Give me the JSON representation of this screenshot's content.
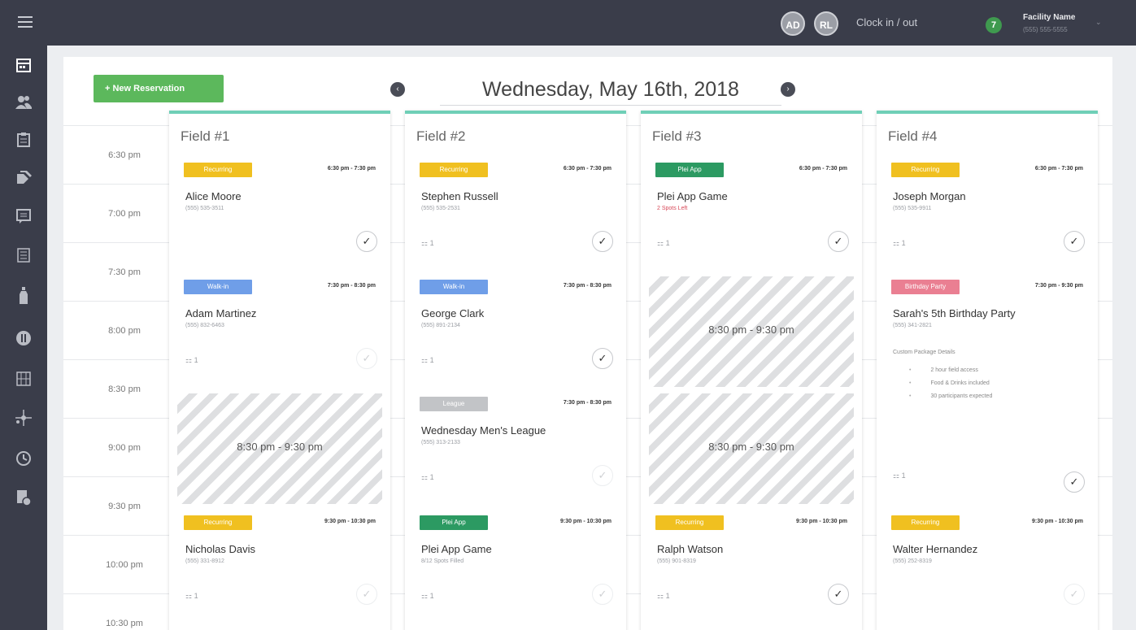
{
  "topbar": {
    "menu_icon": "hamburger-icon",
    "avatars": [
      "AD",
      "RL"
    ],
    "clock_label": "Clock in / out",
    "facility_badge": "7",
    "facility_name": "Facility Name",
    "facility_phone": "(555) 555-5555"
  },
  "sidebar": {
    "icons": [
      "calendar-icon",
      "users-icon",
      "clipboard-icon",
      "tags-icon",
      "message-icon",
      "list-icon",
      "bottle-icon",
      "whistle-icon",
      "grid-icon",
      "network-icon",
      "history-icon",
      "settings-doc-icon"
    ]
  },
  "toolbar": {
    "new_reservation": "+ New Reservation",
    "prev_icon": "chevron-left-icon",
    "next_icon": "chevron-right-icon",
    "date": "Wednesday, May 16th, 2018"
  },
  "times": [
    "6:30 pm",
    "7:00 pm",
    "7:30 pm",
    "8:00 pm",
    "8:30 pm",
    "9:00 pm",
    "9:30 pm",
    "10:00 pm",
    "10:30 pm"
  ],
  "fields": [
    {
      "title": "Field #1",
      "cards": [
        {
          "tag": "Recurring",
          "time": "6:30 pm - 7:30 pm",
          "name": "Alice Moore",
          "sub": "(555) 535-3511",
          "count": ""
        },
        {
          "tag": "Walk-in",
          "time": "7:30 pm - 8:30 pm",
          "name": "Adam Martinez",
          "sub": "(555) 832-6463",
          "count": "1"
        },
        {
          "block": "8:30 pm - 9:30 pm"
        },
        {
          "tag": "Recurring",
          "time": "9:30 pm - 10:30 pm",
          "name": "Nicholas Davis",
          "sub": "(555) 331-8912",
          "count": "1"
        }
      ]
    },
    {
      "title": "Field #2",
      "cards": [
        {
          "tag": "Recurring",
          "time": "6:30 pm - 7:30 pm",
          "name": "Stephen Russell",
          "sub": "(555) 535-2531",
          "count": "1"
        },
        {
          "tag": "Walk-in",
          "time": "7:30 pm - 8:30 pm",
          "name": "George Clark",
          "sub": "(555) 891-2134",
          "count": "1"
        },
        {
          "tag": "League",
          "time": "7:30 pm - 8:30 pm",
          "name": "Wednesday Men's League",
          "sub": "(555) 313-2133",
          "count": "1"
        },
        {
          "tag": "Plei App",
          "time": "9:30 pm - 10:30 pm",
          "name": "Plei App Game",
          "sub": "8/12 Spots Filled",
          "count": "1"
        }
      ]
    },
    {
      "title": "Field #3",
      "cards": [
        {
          "tag": "Plei App",
          "time": "6:30 pm - 7:30 pm",
          "name": "Plei App Game",
          "sub": "2 Spots Left",
          "count": "1"
        },
        {
          "block": "8:30 pm - 9:30 pm"
        },
        {
          "block": "8:30 pm - 9:30 pm"
        },
        {
          "tag": "Recurring",
          "time": "9:30 pm - 10:30 pm",
          "name": "Ralph Watson",
          "sub": "(555) 901-8319",
          "count": "1"
        }
      ]
    },
    {
      "title": "Field #4",
      "cards": [
        {
          "tag": "Recurring",
          "time": "6:30 pm - 7:30 pm",
          "name": "Joseph Morgan",
          "sub": "(555) 535-9911",
          "count": "1"
        },
        {
          "tag": "Birthday Party",
          "time": "7:30 pm - 9:30 pm",
          "name": "Sarah's 5th Birthday Party",
          "sub": "(555) 341-2821",
          "count": "1",
          "package_title": "Custom Package Details",
          "package": [
            "2 hour field access",
            "Food & Drinks included",
            "30 participants expected"
          ]
        },
        {
          "tag": "Recurring",
          "time": "9:30 pm - 10:30 pm",
          "name": "Walter Hernandez",
          "sub": "(555) 252-8319",
          "count": "1"
        }
      ]
    }
  ]
}
